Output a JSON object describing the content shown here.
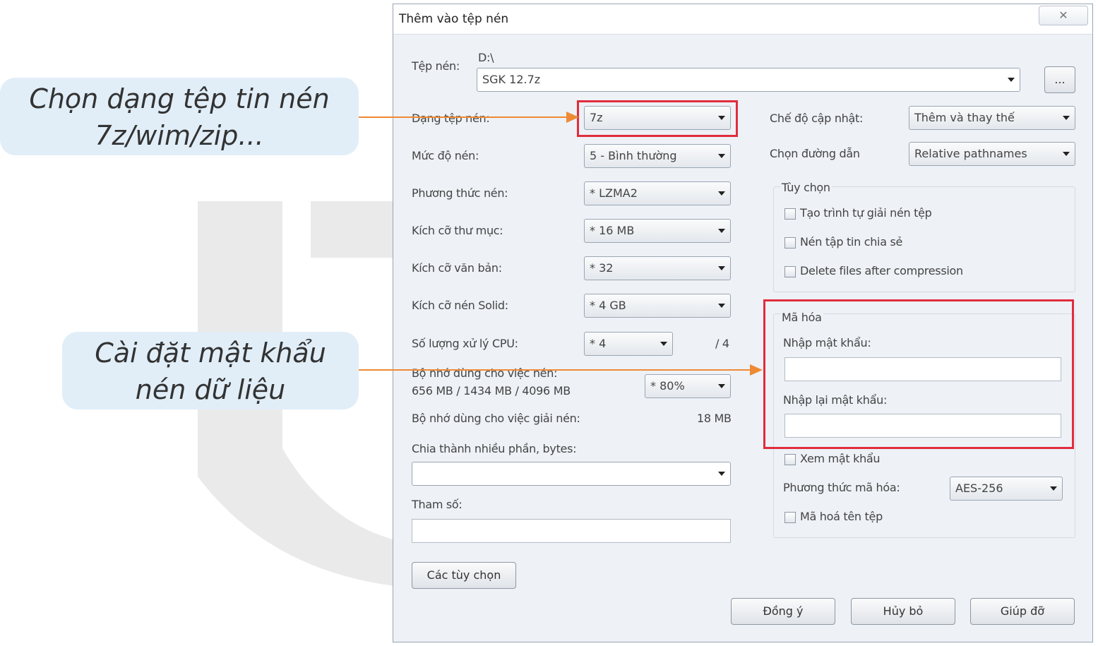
{
  "callouts": {
    "format": [
      "Chọn dạng tệp tin nén",
      "7z/wim/zip..."
    ],
    "password": [
      "Cài đặt mật khẩu",
      "nén dữ liệu"
    ]
  },
  "colors": {
    "arrow": "#ee8a35",
    "highlight": "#e02d3c",
    "callout_bg": "#e1eef8"
  },
  "dialog": {
    "title": "Thêm vào tệp nén",
    "close_icon": "close-icon",
    "archive": {
      "label": "Tệp nén:",
      "path": "D:\\",
      "value": "SGK 12.7z",
      "browse_label": "..."
    },
    "left": {
      "format": {
        "label": "Dạng tệp nén:",
        "value": "7z"
      },
      "level": {
        "label": "Mức độ nén:",
        "value": "5 - Bình thường"
      },
      "method": {
        "label": "Phương thức nén:",
        "value": "* LZMA2"
      },
      "dict": {
        "label": "Kích cỡ thư mục:",
        "value": "* 16 MB"
      },
      "word": {
        "label": "Kích cỡ văn bản:",
        "value": "* 32"
      },
      "solid": {
        "label": "Kích cỡ nén Solid:",
        "value": "* 4 GB"
      },
      "threads": {
        "label": "Số lượng xử lý CPU:",
        "value": "* 4",
        "max": "/ 4"
      },
      "mem_compress": {
        "label": "Bộ nhớ dùng cho việc nén:",
        "detail": "656 MB / 1434 MB / 4096 MB",
        "value": "* 80%"
      },
      "mem_decompress": {
        "label": "Bộ nhớ dùng cho việc giải nén:",
        "value": "18 MB"
      },
      "split": {
        "label": "Chia thành nhiều phần, bytes:",
        "value": ""
      },
      "params": {
        "label": "Tham số:",
        "value": ""
      },
      "options_button": "Các tùy chọn"
    },
    "right": {
      "update_mode": {
        "label": "Chế độ cập nhật:",
        "value": "Thêm và thay thế"
      },
      "path_mode": {
        "label": "Chọn đường dẫn",
        "value": "Relative pathnames"
      },
      "options": {
        "title": "Tùy chọn",
        "items": [
          "Tạo trình tự giải nén tệp",
          "Nén tập tin chia sẻ",
          "Delete files after compression"
        ]
      },
      "encryption": {
        "title": "Mã hóa",
        "password_label": "Nhập mật khẩu:",
        "password_value": "",
        "reenter_label": "Nhập lại mật khẩu:",
        "reenter_value": "",
        "show_password": "Xem mật khẩu",
        "method_label": "Phương thức mã hóa:",
        "method_value": "AES-256",
        "encrypt_names": "Mã hoá tên tệp"
      }
    },
    "buttons": {
      "ok": "Đồng ý",
      "cancel": "Hủy bỏ",
      "help": "Giúp đỡ"
    }
  }
}
